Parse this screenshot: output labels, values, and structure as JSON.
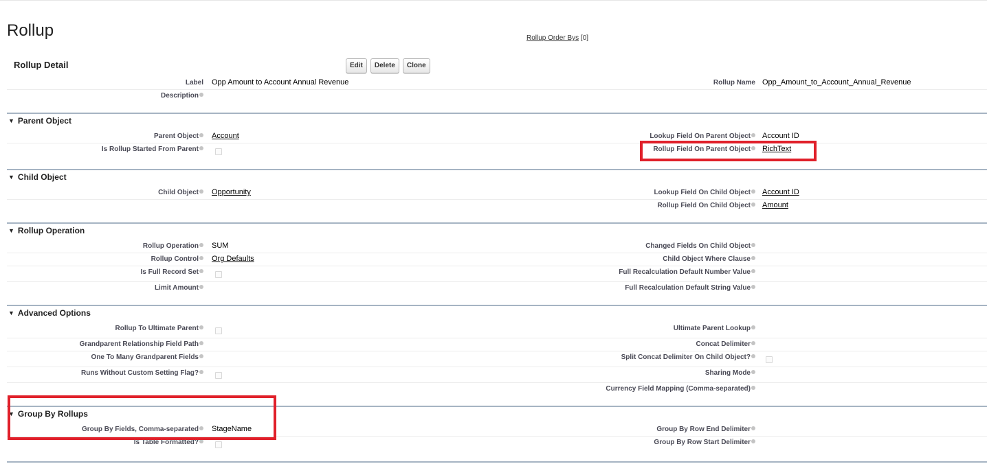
{
  "page": {
    "title": "Rollup",
    "related_link": "Rollup Order Bys",
    "related_count": "[0]"
  },
  "detail": {
    "title": "Rollup Detail",
    "buttons": {
      "edit": "Edit",
      "delete": "Delete",
      "clone": "Clone"
    },
    "label_label": "Label",
    "label_value": "Opp Amount to Account Annual Revenue",
    "rollup_name_label": "Rollup Name",
    "rollup_name_value": "Opp_Amount_to_Account_Annual_Revenue",
    "description_label": "Description"
  },
  "parent": {
    "title": "Parent Object",
    "parent_object_label": "Parent Object",
    "parent_object_value": "Account",
    "lookup_label": "Lookup Field On Parent Object",
    "lookup_value": "Account ID",
    "started_label": "Is Rollup Started From Parent",
    "started_checked": false,
    "rollup_field_label": "Rollup Field On Parent Object",
    "rollup_field_value": "RichText"
  },
  "child": {
    "title": "Child Object",
    "child_object_label": "Child Object",
    "child_object_value": "Opportunity",
    "lookup_label": "Lookup Field On Child Object",
    "lookup_value": "Account ID",
    "rollup_field_label": "Rollup Field On Child Object",
    "rollup_field_value": "Amount"
  },
  "operation": {
    "title": "Rollup Operation",
    "op_label": "Rollup Operation",
    "op_value": "SUM",
    "changed_label": "Changed Fields On Child Object",
    "control_label": "Rollup Control",
    "control_value": "Org Defaults",
    "where_label": "Child Object Where Clause",
    "full_set_label": "Is Full Record Set",
    "full_recalc_num_label": "Full Recalculation Default Number Value",
    "limit_label": "Limit Amount",
    "full_recalc_str_label": "Full Recalculation Default String Value"
  },
  "advanced": {
    "title": "Advanced Options",
    "ultimate_label": "Rollup To Ultimate Parent",
    "ultimate_lookup_label": "Ultimate Parent Lookup",
    "gp_path_label": "Grandparent Relationship Field Path",
    "concat_label": "Concat Delimiter",
    "one_to_many_label": "One To Many Grandparent Fields",
    "split_label": "Split Concat Delimiter On Child Object?",
    "runs_without_label": "Runs Without Custom Setting Flag?",
    "sharing_label": "Sharing Mode",
    "currency_label": "Currency Field Mapping (Comma-separated)"
  },
  "groupby": {
    "title": "Group By Rollups",
    "fields_label": "Group By Fields, Comma-separated",
    "fields_value": "StageName",
    "row_end_label": "Group By Row End Delimiter",
    "table_formatted_label": "Is Table Formatted?",
    "row_start_label": "Group By Row Start Delimiter"
  },
  "colors": {
    "highlight": "#e0202a",
    "section_rule": "#a6b4c3"
  }
}
